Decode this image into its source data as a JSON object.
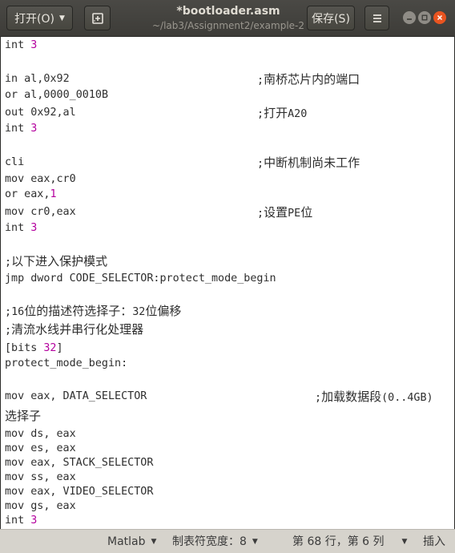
{
  "header": {
    "open_label": "打开(O)",
    "title": "*bootloader.asm",
    "subtitle": "~/lab3/Assignment2/example-2",
    "save_label": "保存(S)"
  },
  "editor": {
    "lines": [
      {
        "code": "int 3"
      },
      {
        "code": ""
      },
      {
        "code": "in al,0x92",
        "comment": ";南桥芯片内的端口"
      },
      {
        "code": "or al,0000_0010B"
      },
      {
        "code": "out 0x92,al",
        "comment": ";打开A20"
      },
      {
        "code": "int 3"
      },
      {
        "code": ""
      },
      {
        "code": "cli",
        "comment": ";中断机制尚未工作"
      },
      {
        "code": "mov eax,cr0"
      },
      {
        "code": "or eax,1"
      },
      {
        "code": "mov cr0,eax",
        "comment": ";设置PE位"
      },
      {
        "code": "int 3"
      },
      {
        "code": ""
      },
      {
        "code": ";以下进入保护模式"
      },
      {
        "code": "jmp dword CODE_SELECTOR:protect_mode_begin"
      },
      {
        "code": ""
      },
      {
        "code": ";16位的描述符选择子：32位偏移"
      },
      {
        "code": ";清流水线并串行化处理器"
      },
      {
        "code": "[bits 32]"
      },
      {
        "code": "protect_mode_begin:"
      },
      {
        "code": ""
      },
      {
        "code": "mov eax, DATA_SELECTOR",
        "comment": ";加载数据段(0..4GB)"
      },
      {
        "code": "选择子"
      },
      {
        "code": "mov ds, eax"
      },
      {
        "code": "mov es, eax"
      },
      {
        "code": "mov eax, STACK_SELECTOR"
      },
      {
        "code": "mov ss, eax"
      },
      {
        "code": "mov eax, VIDEO_SELECTOR"
      },
      {
        "code": "mov gs, eax"
      },
      {
        "code": "int 3"
      }
    ]
  },
  "statusbar": {
    "language": "Matlab",
    "tab_width": "制表符宽度：8",
    "position": "第 68 行，第 6 列",
    "mode": "插入"
  },
  "colors": {
    "header_bg": "#3d3c38",
    "number": "#b4009e",
    "close_button": "#e95420",
    "statusbar_bg": "#d6d3cc"
  },
  "icons": [
    "new-document-icon",
    "hamburger-menu-icon",
    "minimize-icon",
    "maximize-icon",
    "close-icon",
    "dropdown-caret-icon"
  ]
}
